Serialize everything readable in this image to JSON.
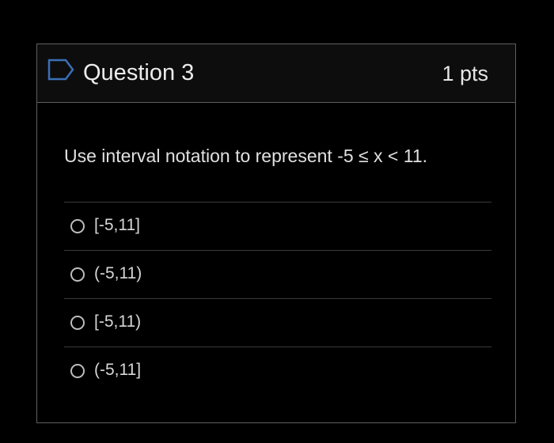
{
  "question": {
    "title": "Question 3",
    "points": "1 pts",
    "flag_icon": "flag-outline-icon",
    "prompt": "Use interval notation to represent -5 ≤ x < 11.",
    "answers": [
      {
        "label": "[-5,11]",
        "selected": false
      },
      {
        "label": "(-5,11)",
        "selected": false
      },
      {
        "label": "[-5,11)",
        "selected": false
      },
      {
        "label": "(-5,11]",
        "selected": false
      }
    ]
  },
  "colors": {
    "background": "#000000",
    "header_background": "#0d0d0d",
    "border": "#5f5f5f",
    "flag": "#3b6fb6",
    "text": "#e6e6e6"
  }
}
